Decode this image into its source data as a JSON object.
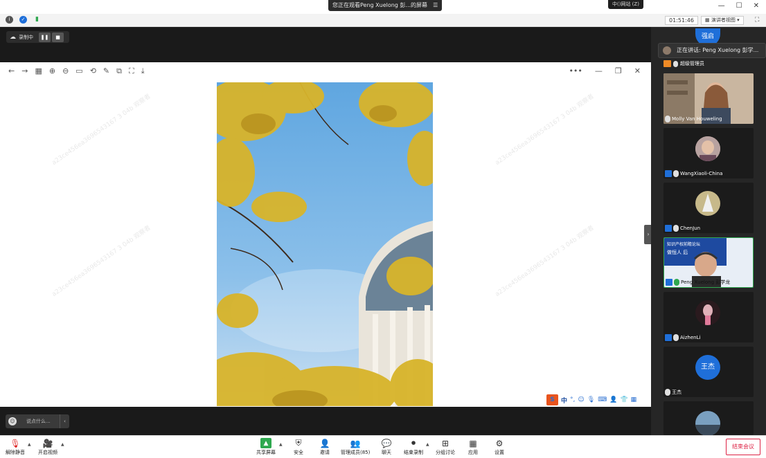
{
  "titlebar": {
    "share_banner": "您正在观看Peng Xuelong 彭...的屏幕",
    "banner_menu_icon": "menu-icon",
    "mini_pill": "中()网站 (Z)"
  },
  "statusbar": {
    "time": "01:51:46",
    "view_mode": "演讲者视图"
  },
  "stage": {
    "recording_label": "录制中",
    "chat_placeholder": "说点什么..."
  },
  "ime": {
    "logo": "S",
    "lang": "中"
  },
  "gallery": {
    "speaking_label": "正在讲话: Peng Xuelong 彭学...",
    "admin_label": "超级管理员",
    "top_avatar_text": "强启",
    "tiles": [
      {
        "name": "Molly Van Houweling"
      },
      {
        "name": "WangXiaoli-China"
      },
      {
        "name": "ChenJun"
      },
      {
        "name": "Peng Xuelong 彭学龙",
        "slide_title": "知识产权前瞻论坛",
        "slide_sub": "做恒人 后"
      },
      {
        "name": "AizhenLi"
      },
      {
        "name": "王杰",
        "avatar_text": "王杰"
      }
    ]
  },
  "toolbar": {
    "unmute": "解除静音",
    "start_video": "开启视频",
    "share_screen": "共享屏幕",
    "security": "安全",
    "invite": "邀请",
    "participants": "管理成员(85)",
    "chat": "聊天",
    "end_recording": "结束录制",
    "breakout": "分组讨论",
    "apps": "应用",
    "settings": "设置",
    "end_meeting": "结束会议"
  },
  "colors": {
    "accent_blue": "#1f6fd9",
    "end_red": "#d22244",
    "admin_orange": "#ef8a26"
  }
}
